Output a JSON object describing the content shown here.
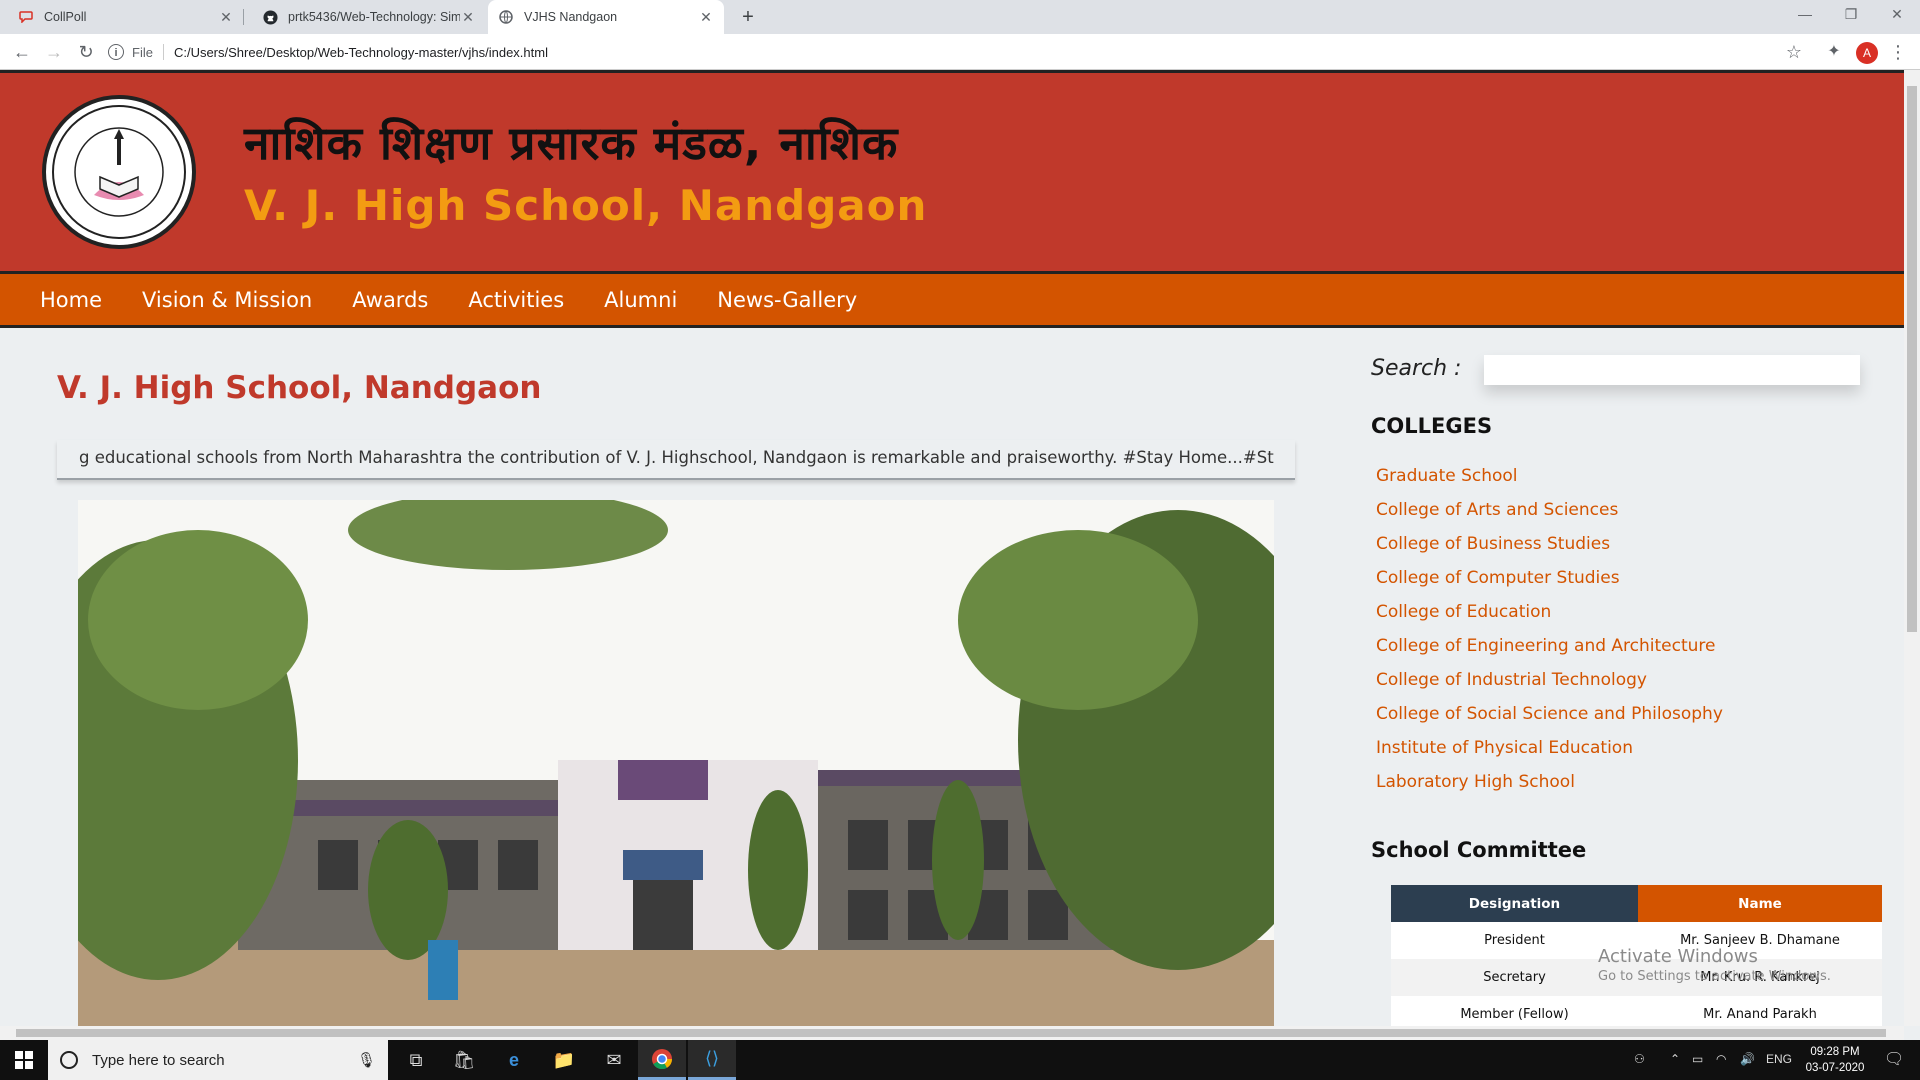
{
  "browser": {
    "tabs": [
      {
        "title": "CollPoll",
        "icon": "chat-bubble-icon"
      },
      {
        "title": "prtk5436/Web-Technology: Simp",
        "icon": "github-icon"
      },
      {
        "title": "VJHS Nandgaon",
        "icon": "globe-icon",
        "active": true
      }
    ],
    "address": {
      "scheme_label": "File",
      "url": "C:/Users/Shree/Desktop/Web-Technology-master/vjhs/index.html"
    },
    "profile_initial": "A"
  },
  "header": {
    "title_marathi": "नाशिक  शिक्षण प्रसारक  मंडळ, नाशिक",
    "title_english": "V. J. High School, Nandgaon"
  },
  "nav": {
    "items": [
      "Home",
      "Vision & Mission",
      "Awards",
      "Activities",
      "Alumni",
      "News-Gallery"
    ]
  },
  "main": {
    "title": "V. J. High School, Nandgaon",
    "marquee": "g educational schools from North Maharashtra the contribution of V. J. Highschool, Nandgaon is remarkable and praiseworthy. #Stay Home...#Stay Safe"
  },
  "sidebar": {
    "search_label": "Search :",
    "search_value": "",
    "colleges_title": "COLLEGES",
    "colleges": [
      "Graduate School",
      "College of Arts and Sciences",
      "College of Business Studies",
      "College of Computer Studies",
      "College of Education",
      "College of Engineering and Architecture",
      "College of Industrial Technology",
      "College of Social Science and Philosophy",
      "Institute of Physical Education",
      "Laboratory High School"
    ],
    "committee_title": "School Committee",
    "committee_headers": [
      "Designation",
      "Name"
    ],
    "committee_rows": [
      [
        "President",
        "Mr. Sanjeev B. Dhamane"
      ],
      [
        "Secretary",
        "Mr. Kru. R. Kankrej"
      ],
      [
        "Member (Fellow)",
        "Mr. Anand Parakh"
      ]
    ]
  },
  "watermark": {
    "line1": "Activate Windows",
    "line2": "Go to Settings to activate Windows."
  },
  "taskbar": {
    "search_placeholder": "Type here to search",
    "lang": "ENG",
    "time": "09:28 PM",
    "date": "03-07-2020"
  },
  "colors": {
    "header_red": "#c0392b",
    "nav_orange": "#d35400",
    "title_orange": "#f39c12",
    "table_dark": "#2c3e50"
  }
}
